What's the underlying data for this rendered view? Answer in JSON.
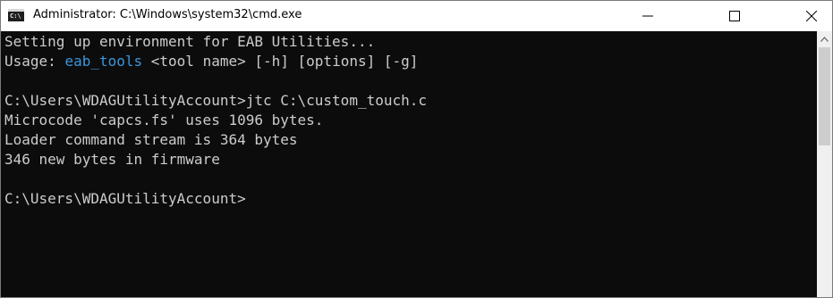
{
  "window": {
    "title": "Administrator: C:\\Windows\\system32\\cmd.exe",
    "icon": "cmd-icon",
    "icon_label": "C:\\",
    "controls": [
      "minimize-icon",
      "maximize-icon",
      "close-icon"
    ]
  },
  "console": {
    "lines": [
      "Setting up environment for EAB Utilities...",
      {
        "before": "Usage: ",
        "highlight": "eab_tools",
        "after": " <tool name> [-h] [options] [-g]"
      },
      "",
      "C:\\Users\\WDAGUtilityAccount>jtc C:\\custom_touch.c",
      "Microcode 'capcs.fs' uses 1096 bytes.",
      "Loader command stream is 364 bytes",
      "346 new bytes in firmware",
      "",
      "C:\\Users\\WDAGUtilityAccount>"
    ]
  },
  "colors": {
    "background": "#0c0c0c",
    "text": "#cccccc",
    "highlight": "#3a96dd"
  }
}
